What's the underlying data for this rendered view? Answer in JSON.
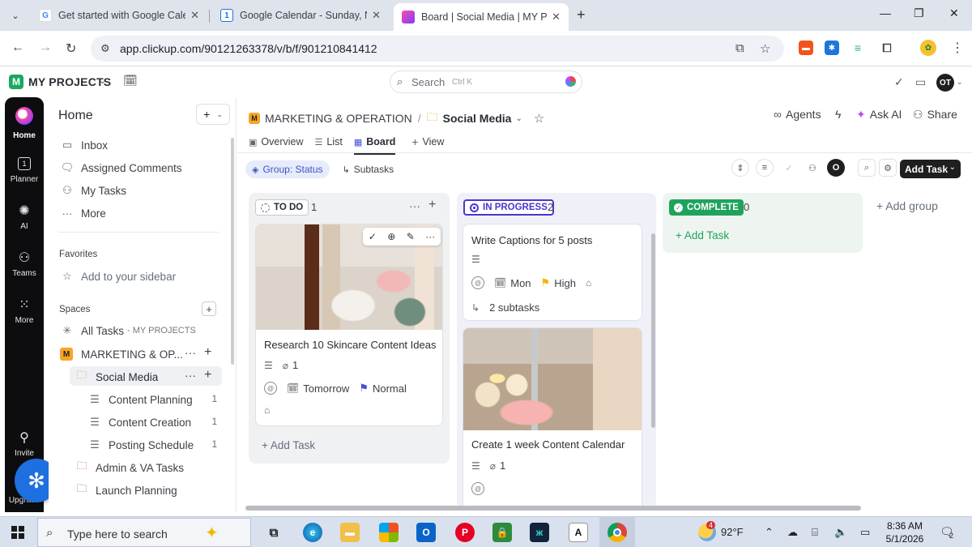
{
  "browser": {
    "tabs": [
      {
        "title": "Get started with Google Calend",
        "icon": "google-g-icon"
      },
      {
        "title": "Google Calendar - Sunday, Nov",
        "icon": "google-calendar-icon",
        "icon_text": "1"
      },
      {
        "title": "Board | Social Media | MY PROJ",
        "icon": "clickup-icon"
      }
    ],
    "url": "app.clickup.com/90121263378/v/b/f/901210841412"
  },
  "app_header": {
    "workspace_initial": "M",
    "workspace_name": "MY PROJECTS",
    "search_placeholder": "Search",
    "search_shortcut": "Ctrl K",
    "avatar_initials": "OT"
  },
  "rail": {
    "items": [
      {
        "label": "Home",
        "icon": "home-icon"
      },
      {
        "label": "Planner",
        "icon": "calendar-icon",
        "icon_text": "1"
      },
      {
        "label": "AI",
        "icon": "ai-icon"
      },
      {
        "label": "Teams",
        "icon": "teams-icon"
      },
      {
        "label": "More",
        "icon": "grid-icon"
      },
      {
        "label": "Invite",
        "icon": "invite-icon"
      },
      {
        "label": "Upgrade",
        "icon": "upgrade-icon"
      }
    ]
  },
  "sidebar": {
    "title": "Home",
    "nav": [
      {
        "label": "Inbox",
        "icon": "inbox-icon"
      },
      {
        "label": "Assigned Comments",
        "icon": "comment-icon"
      },
      {
        "label": "My Tasks",
        "icon": "user-icon"
      },
      {
        "label": "More",
        "icon": "more-icon"
      }
    ],
    "favorites_header": "Favorites",
    "favorites_add": "Add to your sidebar",
    "spaces_header": "Spaces",
    "all_tasks": "All Tasks",
    "all_tasks_suffix": "- MY PROJECTS",
    "space_initial": "M",
    "space_name": "MARKETING & OP...",
    "folder_name": "Social Media",
    "lists": [
      {
        "label": "Content Planning",
        "count": "1"
      },
      {
        "label": "Content Creation",
        "count": "1"
      },
      {
        "label": "Posting Schedule",
        "count": "1"
      }
    ],
    "other_folders": [
      "Admin & VA Tasks",
      "Launch Planning"
    ]
  },
  "main": {
    "breadcrumb_space": "MARKETING & OPERATION",
    "breadcrumb_sep": "/",
    "breadcrumb_folder": "Social Media",
    "top_actions": {
      "agents": "Agents",
      "ask_ai": "Ask AI",
      "share": "Share"
    },
    "views": [
      {
        "label": "Overview",
        "icon": "overview-icon"
      },
      {
        "label": "List",
        "icon": "list-icon"
      },
      {
        "label": "Board",
        "icon": "board-icon"
      },
      {
        "label": "View",
        "icon": "plus-icon"
      }
    ],
    "group_chip": "Group: Status",
    "subtasks_chip": "Subtasks",
    "me_initial": "O",
    "add_task_button": "Add Task",
    "add_group": "+ Add group",
    "columns": [
      {
        "status": "TO DO",
        "count": "1",
        "add_task": "+ Add Task"
      },
      {
        "status": "IN PROGRESS",
        "count": "2"
      },
      {
        "status": "COMPLETE",
        "count": "0",
        "add_task": "+ Add Task"
      }
    ],
    "cards": {
      "skincare": {
        "title": "Research 10 Skincare Content Ideas",
        "attachments": "1",
        "due": "Tomorrow",
        "priority": "Normal"
      },
      "captions": {
        "title": "Write Captions for 5 posts",
        "due": "Mon",
        "priority": "High",
        "subtasks": "2 subtasks"
      },
      "calendar": {
        "title": "Create 1 week Content Calendar",
        "attachments": "1"
      }
    }
  },
  "taskbar": {
    "search_placeholder": "Type here to search",
    "weather_badge": "4",
    "temperature": "92°F",
    "time": "8:36 AM",
    "date": "5/1/2026",
    "notifications": "2"
  }
}
